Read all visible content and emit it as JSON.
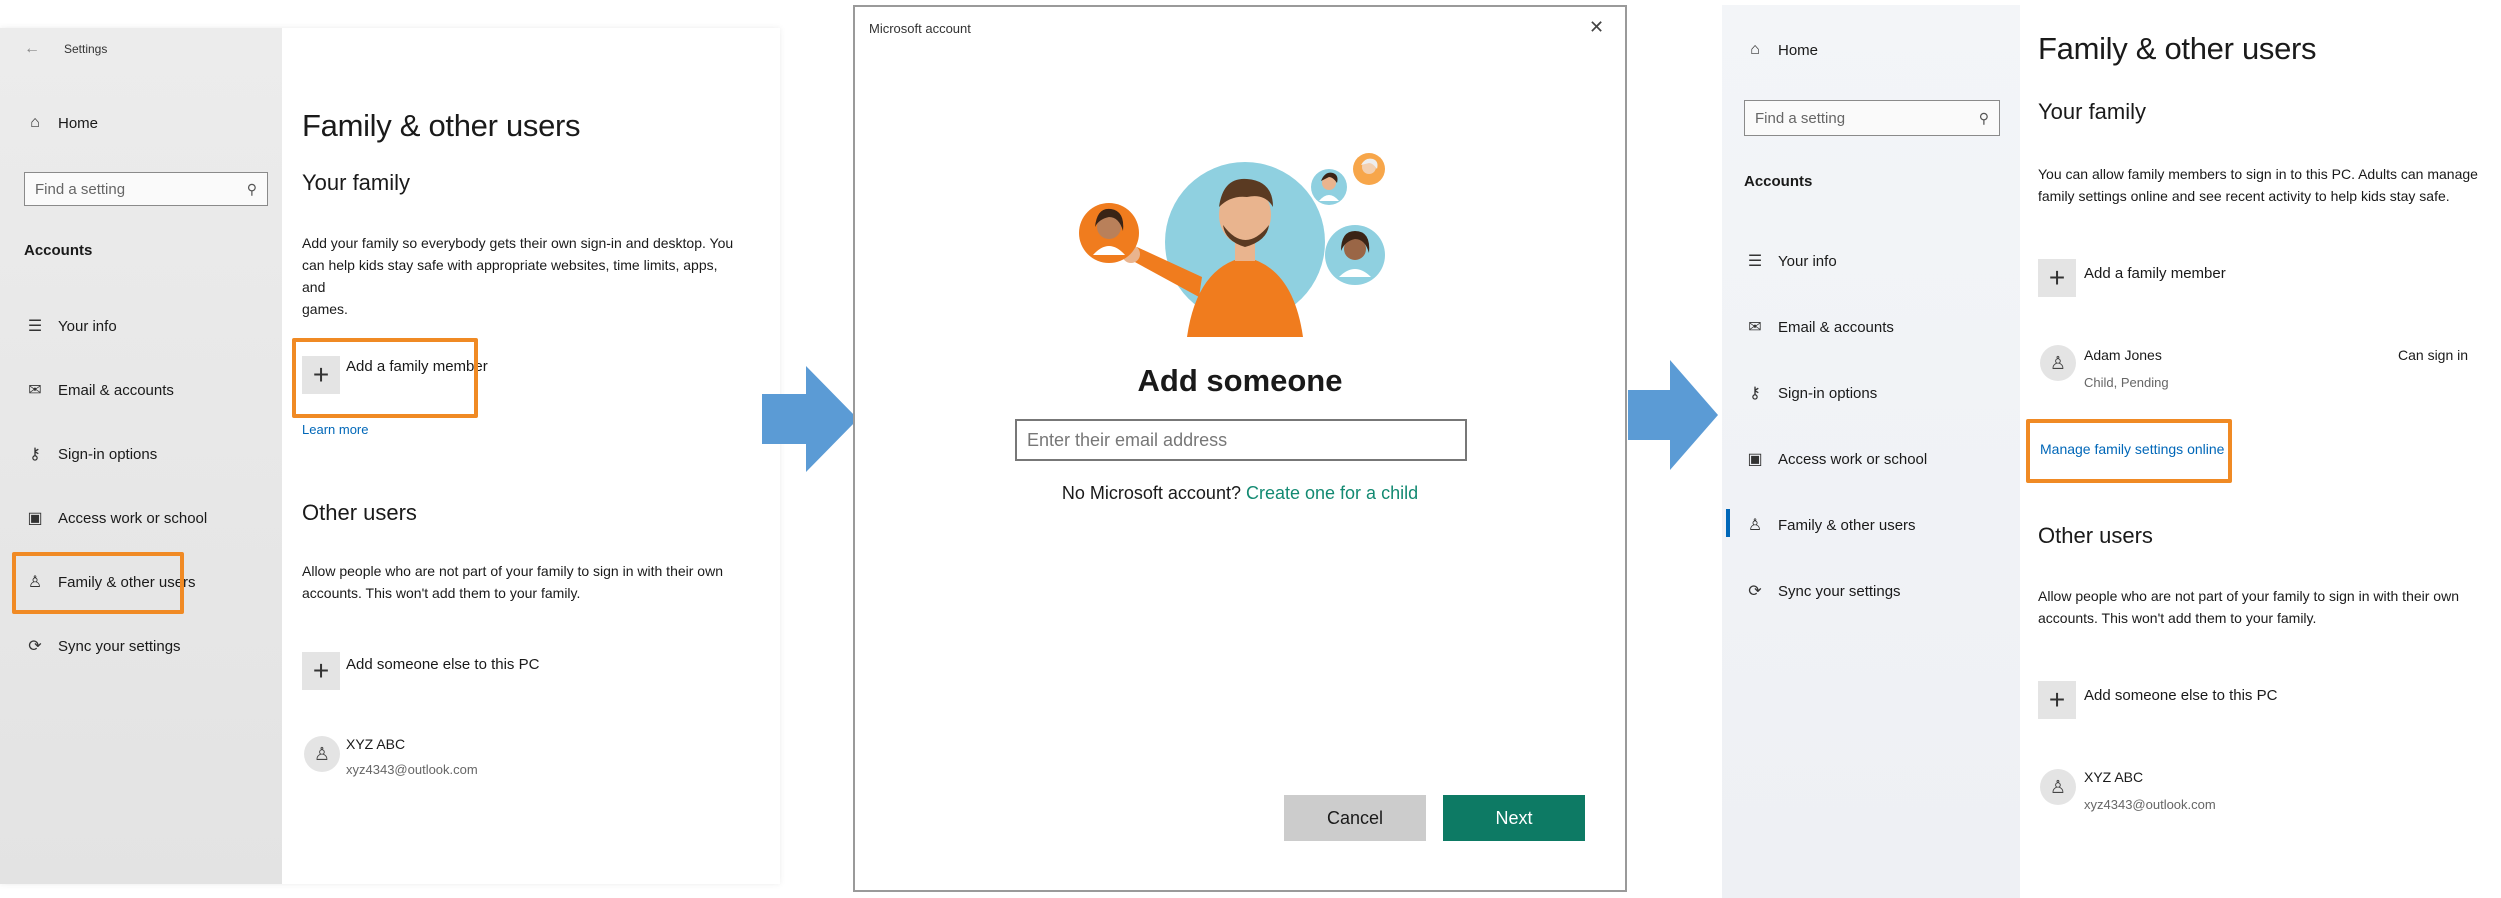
{
  "panel1": {
    "window_title": "Settings",
    "home": "Home",
    "search_placeholder": "Find a setting",
    "section": "Accounts",
    "nav": [
      "Your info",
      "Email & accounts",
      "Sign-in options",
      "Access work or school",
      "Family & other users",
      "Sync your settings"
    ],
    "page_title": "Family & other users",
    "your_family_heading": "Your family",
    "your_family_desc_1": "Add your family so everybody gets their own sign-in and desktop. You",
    "your_family_desc_2": "can help kids stay safe with appropriate websites, time limits, apps, and",
    "your_family_desc_3": "games.",
    "add_family_member": "Add a family member",
    "learn_more": "Learn more",
    "other_users_heading": "Other users",
    "other_users_desc_1": "Allow people who are not part of your family to sign in with their own",
    "other_users_desc_2": "accounts. This won't add them to your family.",
    "add_someone_else": "Add someone else to this PC",
    "user_name": "XYZ ABC",
    "user_email": "xyz4343@outlook.com"
  },
  "panel2": {
    "title": "Microsoft account",
    "close": "✕",
    "heading": "Add someone",
    "email_placeholder": "Enter their email address",
    "no_account_text": "No Microsoft account?",
    "create_child_link": "Create one for a child",
    "cancel": "Cancel",
    "next": "Next"
  },
  "panel3": {
    "home": "Home",
    "search_placeholder": "Find a setting",
    "section": "Accounts",
    "nav": [
      "Your info",
      "Email & accounts",
      "Sign-in options",
      "Access work or school",
      "Family & other users",
      "Sync your settings"
    ],
    "page_title": "Family & other users",
    "your_family_heading": "Your family",
    "your_family_desc_1": "You can allow family members to sign in to this PC. Adults can manage",
    "your_family_desc_2": "family settings online and see recent activity to help kids stay safe.",
    "add_family_member": "Add a family member",
    "member_name": "Adam Jones",
    "member_status": "Child, Pending",
    "member_action": "Can sign in",
    "manage_link": "Manage family settings online",
    "other_users_heading": "Other users",
    "other_users_desc_1": "Allow people who are not part of your family to sign in with their own",
    "other_users_desc_2": "accounts. This won't add them to your family.",
    "add_someone_else": "Add someone else to this PC",
    "user_name": "XYZ ABC",
    "user_email": "xyz4343@outlook.com"
  },
  "colors": {
    "highlight": "#f08a24",
    "arrow": "#5b9bd5",
    "next_button": "#0d7a64",
    "link": "#0067b8",
    "create_link": "#138a72"
  }
}
